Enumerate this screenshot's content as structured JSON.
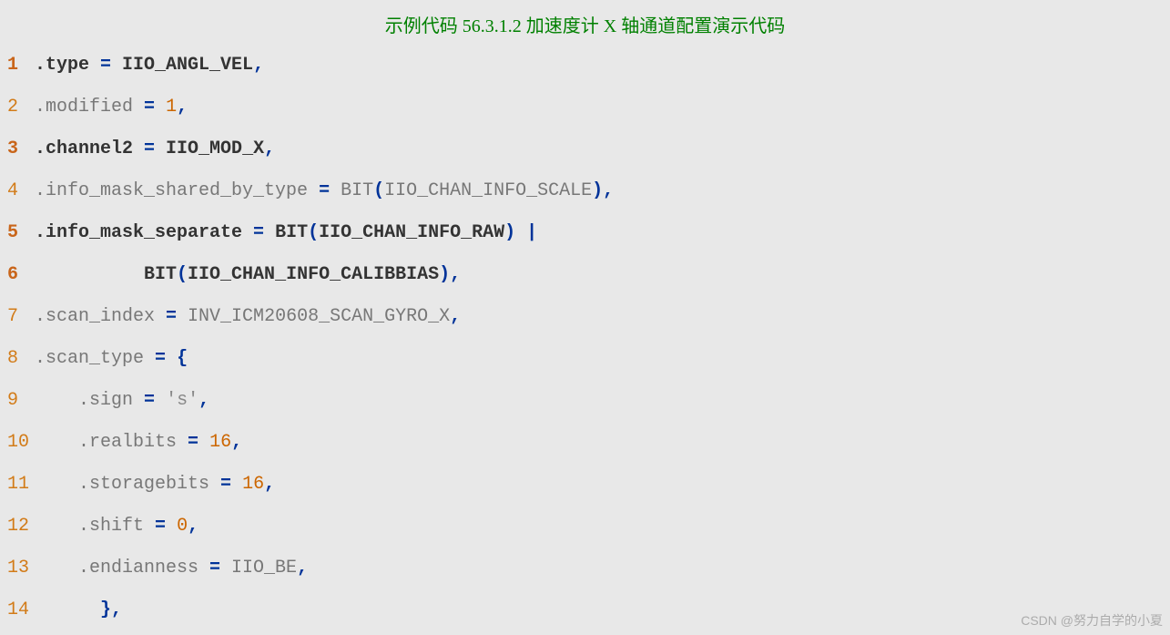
{
  "title": "示例代码 56.3.1.2 加速度计 X 轴通道配置演示代码",
  "watermark": "CSDN @努力自学的小夏",
  "lines": [
    {
      "n": "1",
      "bold": true,
      "segs": [
        {
          "t": ".type ",
          "c": "code"
        },
        {
          "t": "=",
          "c": "op"
        },
        {
          "t": " IIO_ANGL_VEL",
          "c": "code"
        },
        {
          "t": ",",
          "c": "op"
        }
      ]
    },
    {
      "n": "2",
      "bold": false,
      "segs": [
        {
          "t": ".modified ",
          "c": "code"
        },
        {
          "t": "=",
          "c": "op"
        },
        {
          "t": " ",
          "c": "code"
        },
        {
          "t": "1",
          "c": "num"
        },
        {
          "t": ",",
          "c": "op"
        }
      ]
    },
    {
      "n": "3",
      "bold": true,
      "segs": [
        {
          "t": ".channel2 ",
          "c": "code"
        },
        {
          "t": "=",
          "c": "op"
        },
        {
          "t": " IIO_MOD_X",
          "c": "code"
        },
        {
          "t": ",",
          "c": "op"
        }
      ]
    },
    {
      "n": "4",
      "bold": false,
      "segs": [
        {
          "t": ".info_mask_shared_by_type ",
          "c": "code"
        },
        {
          "t": "=",
          "c": "op"
        },
        {
          "t": " BIT",
          "c": "code"
        },
        {
          "t": "(",
          "c": "op"
        },
        {
          "t": "IIO_CHAN_INFO_SCALE",
          "c": "code"
        },
        {
          "t": "),",
          "c": "op"
        }
      ]
    },
    {
      "n": "5",
      "bold": true,
      "segs": [
        {
          "t": ".info_mask_separate ",
          "c": "code"
        },
        {
          "t": "=",
          "c": "op"
        },
        {
          "t": " BIT",
          "c": "code"
        },
        {
          "t": "(",
          "c": "op"
        },
        {
          "t": "IIO_CHAN_INFO_RAW",
          "c": "code"
        },
        {
          "t": ")",
          "c": "op"
        },
        {
          "t": " ",
          "c": "code"
        },
        {
          "t": "|",
          "c": "op"
        }
      ]
    },
    {
      "n": "6",
      "bold": true,
      "segs": [
        {
          "t": "          BIT",
          "c": "code"
        },
        {
          "t": "(",
          "c": "op"
        },
        {
          "t": "IIO_CHAN_INFO_CALIBBIAS",
          "c": "code"
        },
        {
          "t": "),",
          "c": "op"
        }
      ]
    },
    {
      "n": "7",
      "bold": false,
      "segs": [
        {
          "t": ".scan_index ",
          "c": "code"
        },
        {
          "t": "=",
          "c": "op"
        },
        {
          "t": " INV_ICM20608_SCAN_GYRO_X",
          "c": "code"
        },
        {
          "t": ",",
          "c": "op"
        }
      ]
    },
    {
      "n": "8",
      "bold": false,
      "segs": [
        {
          "t": ".scan_type ",
          "c": "code"
        },
        {
          "t": "=",
          "c": "op"
        },
        {
          "t": " ",
          "c": "code"
        },
        {
          "t": "{",
          "c": "op"
        }
      ]
    },
    {
      "n": "9",
      "bold": false,
      "segs": [
        {
          "t": "    .sign ",
          "c": "code"
        },
        {
          "t": "=",
          "c": "op"
        },
        {
          "t": " ",
          "c": "code"
        },
        {
          "t": "'s'",
          "c": "str"
        },
        {
          "t": ",",
          "c": "op"
        }
      ]
    },
    {
      "n": "10",
      "bold": false,
      "segs": [
        {
          "t": "    .realbits ",
          "c": "code"
        },
        {
          "t": "=",
          "c": "op"
        },
        {
          "t": " ",
          "c": "code"
        },
        {
          "t": "16",
          "c": "num"
        },
        {
          "t": ",",
          "c": "op"
        }
      ]
    },
    {
      "n": "11",
      "bold": false,
      "segs": [
        {
          "t": "    .storagebits ",
          "c": "code"
        },
        {
          "t": "=",
          "c": "op"
        },
        {
          "t": " ",
          "c": "code"
        },
        {
          "t": "16",
          "c": "num"
        },
        {
          "t": ",",
          "c": "op"
        }
      ]
    },
    {
      "n": "12",
      "bold": false,
      "segs": [
        {
          "t": "    .shift ",
          "c": "code"
        },
        {
          "t": "=",
          "c": "op"
        },
        {
          "t": " ",
          "c": "code"
        },
        {
          "t": "0",
          "c": "num"
        },
        {
          "t": ",",
          "c": "op"
        }
      ]
    },
    {
      "n": "13",
      "bold": false,
      "segs": [
        {
          "t": "    .endianness ",
          "c": "code"
        },
        {
          "t": "=",
          "c": "op"
        },
        {
          "t": " IIO_BE",
          "c": "code"
        },
        {
          "t": ",",
          "c": "op"
        }
      ]
    },
    {
      "n": "14",
      "bold": false,
      "segs": [
        {
          "t": "      ",
          "c": "code"
        },
        {
          "t": "},",
          "c": "op"
        }
      ]
    }
  ]
}
